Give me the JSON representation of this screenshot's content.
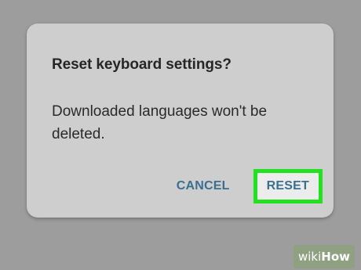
{
  "dialog": {
    "title": "Reset keyboard settings?",
    "message": "Downloaded languages won't be deleted.",
    "cancel_label": "CANCEL",
    "reset_label": "RESET"
  },
  "watermark": {
    "part1": "wiki",
    "part2": "How"
  },
  "colors": {
    "accent": "#3a6f8f",
    "highlight": "#22e11e",
    "dialog_background": "#cecece",
    "screen_background": "#9d9d9d"
  }
}
